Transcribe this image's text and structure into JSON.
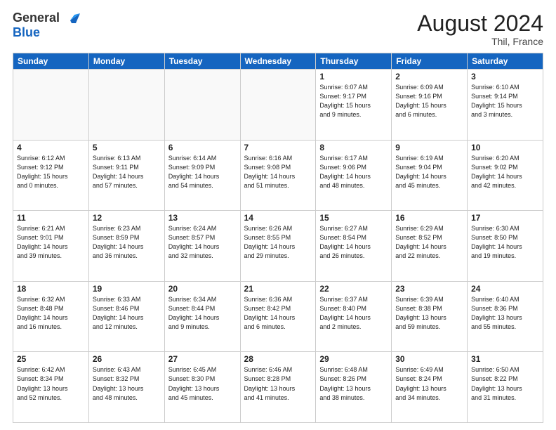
{
  "logo": {
    "general": "General",
    "blue": "Blue"
  },
  "header": {
    "month": "August 2024",
    "location": "Thil, France"
  },
  "weekdays": [
    "Sunday",
    "Monday",
    "Tuesday",
    "Wednesday",
    "Thursday",
    "Friday",
    "Saturday"
  ],
  "weeks": [
    [
      {
        "day": "",
        "info": ""
      },
      {
        "day": "",
        "info": ""
      },
      {
        "day": "",
        "info": ""
      },
      {
        "day": "",
        "info": ""
      },
      {
        "day": "1",
        "info": "Sunrise: 6:07 AM\nSunset: 9:17 PM\nDaylight: 15 hours\nand 9 minutes."
      },
      {
        "day": "2",
        "info": "Sunrise: 6:09 AM\nSunset: 9:16 PM\nDaylight: 15 hours\nand 6 minutes."
      },
      {
        "day": "3",
        "info": "Sunrise: 6:10 AM\nSunset: 9:14 PM\nDaylight: 15 hours\nand 3 minutes."
      }
    ],
    [
      {
        "day": "4",
        "info": "Sunrise: 6:12 AM\nSunset: 9:12 PM\nDaylight: 15 hours\nand 0 minutes."
      },
      {
        "day": "5",
        "info": "Sunrise: 6:13 AM\nSunset: 9:11 PM\nDaylight: 14 hours\nand 57 minutes."
      },
      {
        "day": "6",
        "info": "Sunrise: 6:14 AM\nSunset: 9:09 PM\nDaylight: 14 hours\nand 54 minutes."
      },
      {
        "day": "7",
        "info": "Sunrise: 6:16 AM\nSunset: 9:08 PM\nDaylight: 14 hours\nand 51 minutes."
      },
      {
        "day": "8",
        "info": "Sunrise: 6:17 AM\nSunset: 9:06 PM\nDaylight: 14 hours\nand 48 minutes."
      },
      {
        "day": "9",
        "info": "Sunrise: 6:19 AM\nSunset: 9:04 PM\nDaylight: 14 hours\nand 45 minutes."
      },
      {
        "day": "10",
        "info": "Sunrise: 6:20 AM\nSunset: 9:02 PM\nDaylight: 14 hours\nand 42 minutes."
      }
    ],
    [
      {
        "day": "11",
        "info": "Sunrise: 6:21 AM\nSunset: 9:01 PM\nDaylight: 14 hours\nand 39 minutes."
      },
      {
        "day": "12",
        "info": "Sunrise: 6:23 AM\nSunset: 8:59 PM\nDaylight: 14 hours\nand 36 minutes."
      },
      {
        "day": "13",
        "info": "Sunrise: 6:24 AM\nSunset: 8:57 PM\nDaylight: 14 hours\nand 32 minutes."
      },
      {
        "day": "14",
        "info": "Sunrise: 6:26 AM\nSunset: 8:55 PM\nDaylight: 14 hours\nand 29 minutes."
      },
      {
        "day": "15",
        "info": "Sunrise: 6:27 AM\nSunset: 8:54 PM\nDaylight: 14 hours\nand 26 minutes."
      },
      {
        "day": "16",
        "info": "Sunrise: 6:29 AM\nSunset: 8:52 PM\nDaylight: 14 hours\nand 22 minutes."
      },
      {
        "day": "17",
        "info": "Sunrise: 6:30 AM\nSunset: 8:50 PM\nDaylight: 14 hours\nand 19 minutes."
      }
    ],
    [
      {
        "day": "18",
        "info": "Sunrise: 6:32 AM\nSunset: 8:48 PM\nDaylight: 14 hours\nand 16 minutes."
      },
      {
        "day": "19",
        "info": "Sunrise: 6:33 AM\nSunset: 8:46 PM\nDaylight: 14 hours\nand 12 minutes."
      },
      {
        "day": "20",
        "info": "Sunrise: 6:34 AM\nSunset: 8:44 PM\nDaylight: 14 hours\nand 9 minutes."
      },
      {
        "day": "21",
        "info": "Sunrise: 6:36 AM\nSunset: 8:42 PM\nDaylight: 14 hours\nand 6 minutes."
      },
      {
        "day": "22",
        "info": "Sunrise: 6:37 AM\nSunset: 8:40 PM\nDaylight: 14 hours\nand 2 minutes."
      },
      {
        "day": "23",
        "info": "Sunrise: 6:39 AM\nSunset: 8:38 PM\nDaylight: 13 hours\nand 59 minutes."
      },
      {
        "day": "24",
        "info": "Sunrise: 6:40 AM\nSunset: 8:36 PM\nDaylight: 13 hours\nand 55 minutes."
      }
    ],
    [
      {
        "day": "25",
        "info": "Sunrise: 6:42 AM\nSunset: 8:34 PM\nDaylight: 13 hours\nand 52 minutes."
      },
      {
        "day": "26",
        "info": "Sunrise: 6:43 AM\nSunset: 8:32 PM\nDaylight: 13 hours\nand 48 minutes."
      },
      {
        "day": "27",
        "info": "Sunrise: 6:45 AM\nSunset: 8:30 PM\nDaylight: 13 hours\nand 45 minutes."
      },
      {
        "day": "28",
        "info": "Sunrise: 6:46 AM\nSunset: 8:28 PM\nDaylight: 13 hours\nand 41 minutes."
      },
      {
        "day": "29",
        "info": "Sunrise: 6:48 AM\nSunset: 8:26 PM\nDaylight: 13 hours\nand 38 minutes."
      },
      {
        "day": "30",
        "info": "Sunrise: 6:49 AM\nSunset: 8:24 PM\nDaylight: 13 hours\nand 34 minutes."
      },
      {
        "day": "31",
        "info": "Sunrise: 6:50 AM\nSunset: 8:22 PM\nDaylight: 13 hours\nand 31 minutes."
      }
    ]
  ]
}
